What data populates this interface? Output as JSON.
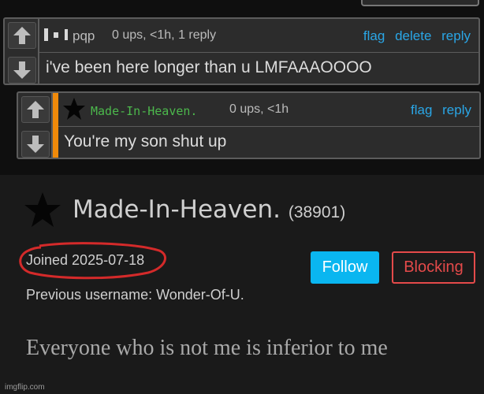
{
  "comments": [
    {
      "username": "pqp",
      "meta": "0 ups, <1h, 1 reply",
      "links": [
        "flag",
        "delete",
        "reply"
      ],
      "text": "i've been here longer than u LMFAAAOOOO",
      "username_color": "#bbbbbb"
    },
    {
      "username": "Made-In-Heaven.",
      "meta": "0 ups, <1h",
      "links": [
        "flag",
        "reply"
      ],
      "text": "You're my son shut up",
      "username_color": "#4cb84c",
      "accent_color": "#f08a0a"
    }
  ],
  "profile": {
    "name": "Made-In-Heaven.",
    "score": "(38901)",
    "joined": "Joined 2025-07-18",
    "previous_username": "Previous username: Wonder-Of-U.",
    "bio": "Everyone who is not me is inferior to me",
    "follow_label": "Follow",
    "blocking_label": "Blocking"
  },
  "watermark": "imgflip.com",
  "colors": {
    "link": "#2aa6e6",
    "follow_bg": "#0ab6f0",
    "blocking": "#e44a4a",
    "annotation_circle": "#d42a2a"
  },
  "icons": {
    "upvote": "arrow-up-icon",
    "downvote": "arrow-down-icon",
    "star": "star-icon",
    "avatar": "pixel-avatar-icon"
  }
}
